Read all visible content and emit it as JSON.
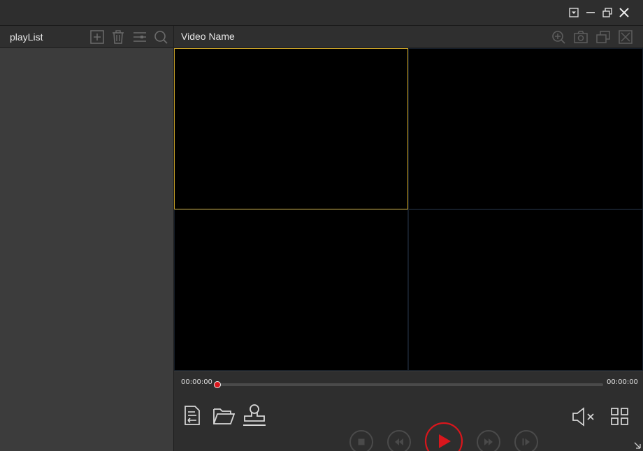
{
  "window": {
    "buttons": [
      "menu-dropdown",
      "minimize",
      "restore",
      "close"
    ]
  },
  "sidebar": {
    "title": "playList",
    "icons": [
      "add-icon",
      "delete-icon",
      "sort-icon",
      "search-icon"
    ]
  },
  "main": {
    "video_name": "Video Name",
    "header_icons": [
      "zoom-in-icon",
      "snapshot-icon",
      "layers-icon",
      "fullscreen-icon"
    ],
    "grid_cells": 4,
    "selected_cell": 1
  },
  "playback": {
    "current_time": "00:00:00",
    "total_time": "00:00:00",
    "progress": 0
  },
  "controls": {
    "left_icons": [
      "playlist-icon",
      "open-folder-icon",
      "stamp-icon"
    ],
    "center_icons": [
      "stop-icon",
      "rewind-icon",
      "play-icon",
      "fast-forward-icon",
      "step-forward-icon"
    ],
    "right_icons": [
      "mute-icon",
      "grid-layout-icon"
    ]
  },
  "colors": {
    "accent": "#d9161c",
    "selection": "#c9a227",
    "background": "#2b2b2b"
  }
}
